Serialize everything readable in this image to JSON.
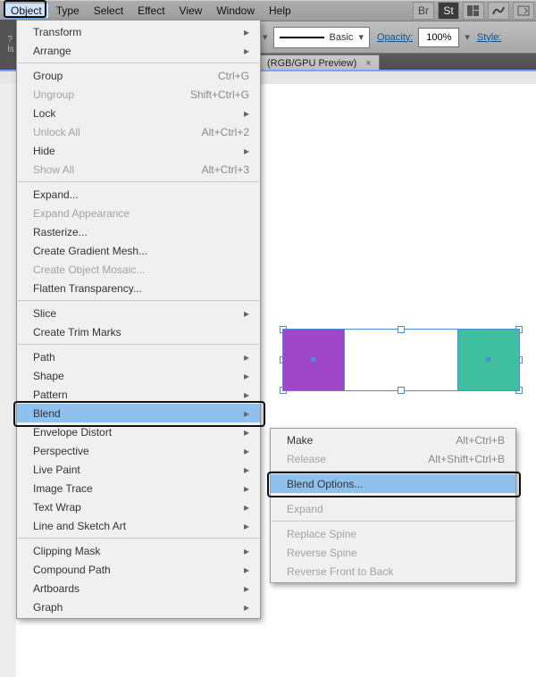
{
  "menubar": {
    "items": [
      "Object",
      "Type",
      "Select",
      "Effect",
      "View",
      "Window",
      "Help"
    ],
    "active_index": 0
  },
  "toolbar": {
    "stroke_style_label": "Basic",
    "opacity_label": "Opacity:",
    "opacity_value": "100%",
    "style_label": "Style:"
  },
  "doctab": {
    "label": "(RGB/GPU Preview)"
  },
  "shapes": {
    "left_color": "#a046c9",
    "right_color": "#3fbfa0"
  },
  "menu": {
    "items": [
      {
        "label": "Transform",
        "submenu": true
      },
      {
        "label": "Arrange",
        "submenu": true
      },
      {
        "sep": true
      },
      {
        "label": "Group",
        "shortcut": "Ctrl+G"
      },
      {
        "label": "Ungroup",
        "shortcut": "Shift+Ctrl+G",
        "disabled": true
      },
      {
        "label": "Lock",
        "submenu": true
      },
      {
        "label": "Unlock All",
        "shortcut": "Alt+Ctrl+2",
        "disabled": true
      },
      {
        "label": "Hide",
        "submenu": true
      },
      {
        "label": "Show All",
        "shortcut": "Alt+Ctrl+3",
        "disabled": true
      },
      {
        "sep": true
      },
      {
        "label": "Expand..."
      },
      {
        "label": "Expand Appearance",
        "disabled": true
      },
      {
        "label": "Rasterize..."
      },
      {
        "label": "Create Gradient Mesh..."
      },
      {
        "label": "Create Object Mosaic...",
        "disabled": true
      },
      {
        "label": "Flatten Transparency..."
      },
      {
        "sep": true
      },
      {
        "label": "Slice",
        "submenu": true
      },
      {
        "label": "Create Trim Marks"
      },
      {
        "sep": true
      },
      {
        "label": "Path",
        "submenu": true
      },
      {
        "label": "Shape",
        "submenu": true
      },
      {
        "label": "Pattern",
        "submenu": true
      },
      {
        "label": "Blend",
        "submenu": true,
        "highlight": true
      },
      {
        "label": "Envelope Distort",
        "submenu": true
      },
      {
        "label": "Perspective",
        "submenu": true
      },
      {
        "label": "Live Paint",
        "submenu": true
      },
      {
        "label": "Image Trace",
        "submenu": true
      },
      {
        "label": "Text Wrap",
        "submenu": true
      },
      {
        "label": "Line and Sketch Art",
        "submenu": true
      },
      {
        "sep": true
      },
      {
        "label": "Clipping Mask",
        "submenu": true
      },
      {
        "label": "Compound Path",
        "submenu": true
      },
      {
        "label": "Artboards",
        "submenu": true
      },
      {
        "label": "Graph",
        "submenu": true
      }
    ]
  },
  "submenu": {
    "items": [
      {
        "label": "Make",
        "shortcut": "Alt+Ctrl+B"
      },
      {
        "label": "Release",
        "shortcut": "Alt+Shift+Ctrl+B",
        "disabled": true
      },
      {
        "sep": true
      },
      {
        "label": "Blend Options...",
        "highlight": true
      },
      {
        "sep": true
      },
      {
        "label": "Expand",
        "disabled": true
      },
      {
        "sep": true
      },
      {
        "label": "Replace Spine",
        "disabled": true
      },
      {
        "label": "Reverse Spine",
        "disabled": true
      },
      {
        "label": "Reverse Front to Back",
        "disabled": true
      }
    ]
  }
}
